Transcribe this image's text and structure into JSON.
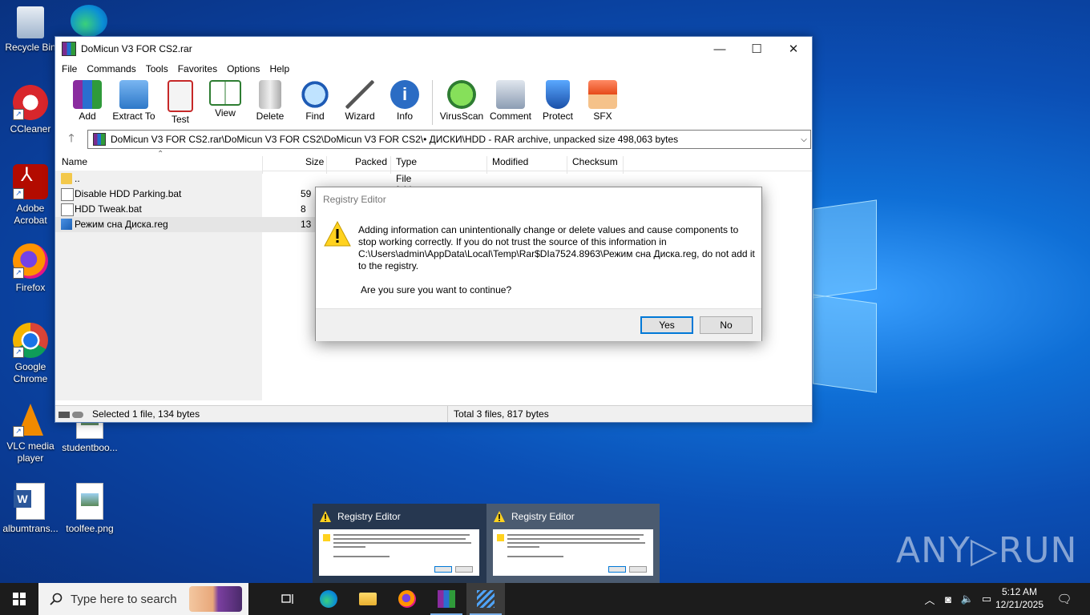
{
  "desktop": {
    "icons": [
      {
        "label": "Recycle Bin",
        "icon": "recycle-bin-icon"
      },
      {
        "label": "CCleaner",
        "icon": "ccleaner-icon"
      },
      {
        "label": "Adobe Acrobat",
        "icon": "acrobat-icon"
      },
      {
        "label": "Firefox",
        "icon": "firefox-icon"
      },
      {
        "label": "Google Chrome",
        "icon": "chrome-icon"
      },
      {
        "label": "VLC media player",
        "icon": "vlc-icon"
      },
      {
        "label": "studentboo...",
        "icon": "image-file-icon"
      },
      {
        "label": "albumtrans...",
        "icon": "word-doc-icon"
      },
      {
        "label": "toolfee.png",
        "icon": "image-file-icon"
      }
    ]
  },
  "winrar": {
    "title": "DoMicun V3 FOR CS2.rar",
    "menu": [
      "File",
      "Commands",
      "Tools",
      "Favorites",
      "Options",
      "Help"
    ],
    "toolbar": [
      "Add",
      "Extract To",
      "Test",
      "View",
      "Delete",
      "Find",
      "Wizard",
      "Info",
      "VirusScan",
      "Comment",
      "Protect",
      "SFX"
    ],
    "address": "DoMicun V3 FOR CS2.rar\\DoMicun V3 FOR CS2\\DoMicun V3 FOR CS2\\• ДИСКИ\\HDD - RAR archive, unpacked size 498,063 bytes",
    "columns": [
      "Name",
      "Size",
      "Packed",
      "Type",
      "Modified",
      "Checksum"
    ],
    "rows": [
      {
        "name": "..",
        "size": "",
        "type": "File folder"
      },
      {
        "name": "Disable HDD Parking.bat",
        "size": "59"
      },
      {
        "name": "HDD Tweak.bat",
        "size": "8"
      },
      {
        "name": "Режим сна Диска.reg",
        "size": "13"
      }
    ],
    "status_left": "Selected 1 file, 134 bytes",
    "status_right": "Total 3 files, 817 bytes"
  },
  "dialog": {
    "title": "Registry Editor",
    "message": "Adding information can unintentionally change or delete values and cause components to stop working correctly. If you do not trust the source of this information in C:\\Users\\admin\\AppData\\Local\\Temp\\Rar$DIa7524.8963\\Режим сна Диска.reg, do not add it to the registry.",
    "question": "Are you sure you want to continue?",
    "yes": "Yes",
    "no": "No"
  },
  "thumbnails": [
    {
      "title": "Registry Editor"
    },
    {
      "title": "Registry Editor"
    }
  ],
  "watermark": "ANY▷RUN",
  "taskbar": {
    "search_placeholder": "Type here to search",
    "time": "5:12 AM",
    "date": "12/21/2025"
  }
}
